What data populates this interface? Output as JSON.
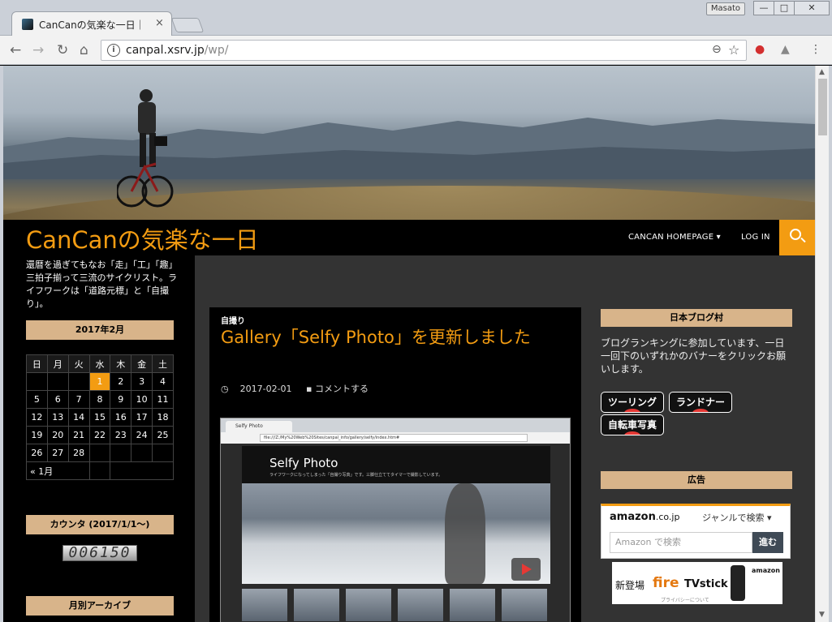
{
  "browser": {
    "tab_title": "CanCanの気楽な一日｜",
    "tab_close": "×",
    "user": "Masato",
    "min": "—",
    "max": "□",
    "close": "✕",
    "url_host": "canpal.xsrv.jp",
    "url_path": "/wp/",
    "info_icon": "i"
  },
  "site": {
    "title": "CanCanの気楽な一日",
    "tagline": "還暦を過ぎてもなお「走」「工」「趣」三拍子揃って三流のサイクリスト。ライフワークは「道路元標」と「自撮り」。",
    "nav": [
      {
        "label": "CANCAN HOMEPAGE ▾"
      },
      {
        "label": "LOG IN"
      }
    ]
  },
  "left_sidebar": {
    "calendar_title": "2017年2月",
    "weekdays": [
      "日",
      "月",
      "火",
      "水",
      "木",
      "金",
      "土"
    ],
    "weeks": [
      [
        "",
        "",
        "",
        "1",
        "2",
        "3",
        "4"
      ],
      [
        "5",
        "6",
        "7",
        "8",
        "9",
        "10",
        "11"
      ],
      [
        "12",
        "13",
        "14",
        "15",
        "16",
        "17",
        "18"
      ],
      [
        "19",
        "20",
        "21",
        "22",
        "23",
        "24",
        "25"
      ],
      [
        "26",
        "27",
        "28",
        "",
        "",
        "",
        ""
      ]
    ],
    "prev_month": "« 1月",
    "counter_title": "カウンタ (2017/1/1～)",
    "counter_value": "006150",
    "archive_title": "月別アーカイブ"
  },
  "post": {
    "category": "自撮り",
    "title": "Gallery「Selfy Photo」を更新しました",
    "date": "2017-02-01",
    "comment": "コメントする",
    "shot": {
      "tab": "Selfy Photo",
      "url": "file:///Z:/My%20Web%20Sites/canpal_info/gallery/selfy/index.htm#",
      "title": "Selfy Photo",
      "subtitle": "ライフワークになってしまった「自撮り写真」です。三脚仕立ててタイマーで撮影しています。"
    }
  },
  "right_sidebar": {
    "blogmura_title": "日本ブログ村",
    "blogmura_text": "ブログランキングに参加しています、一日一回下のいずれかのバナーをクリックお願いします。",
    "buttons": [
      "ツーリング",
      "ランドナー",
      "自転車写真"
    ],
    "ad_title": "広告",
    "amazon_logo": "amazon",
    "amazon_tld": ".co.jp",
    "amazon_genre": "ジャンルで検索 ▾",
    "amazon_placeholder": "Amazon で検索",
    "amazon_go": "進む",
    "firetv_new": "新登場",
    "firetv_fire": "fire",
    "firetv_tv": "TVstick",
    "firetv_brand": "amazon",
    "firetv_privacy": "プライバシーについて"
  }
}
